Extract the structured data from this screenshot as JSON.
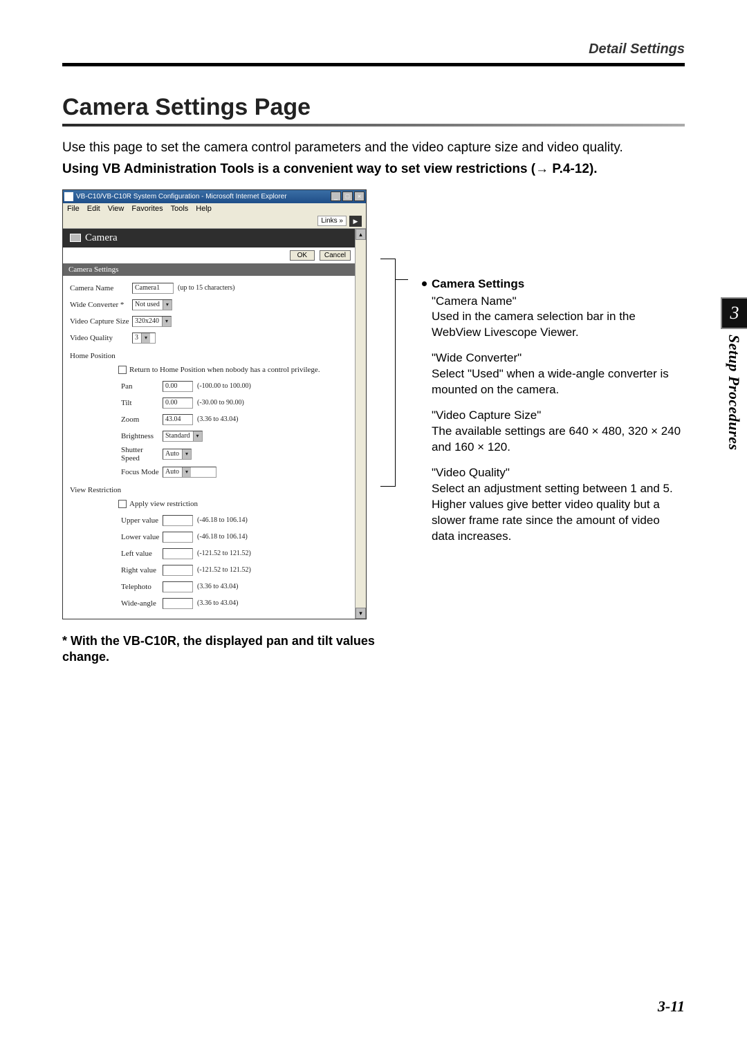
{
  "header": {
    "section_label": "Detail Settings"
  },
  "title": "Camera Settings Page",
  "intro": "Use this page to set the camera control parameters and the video capture size and video quality.",
  "bold_line": "Using VB Administration Tools is a convenient way to set view restrictions (→ P.4-12).",
  "screenshot": {
    "window_title": "VB-C10/VB-C10R System Configuration - Microsoft Internet Explorer",
    "menus": {
      "file": "File",
      "edit": "Edit",
      "view": "View",
      "favorites": "Favorites",
      "tools": "Tools",
      "help": "Help"
    },
    "links_label": "Links »",
    "panel_label": "Camera",
    "ok": "OK",
    "cancel": "Cancel",
    "section_title": "Camera Settings",
    "camera_name_label": "Camera Name",
    "camera_name_value": "Camera1",
    "camera_name_hint": "(up to 15 characters)",
    "wide_converter_label": "Wide Converter  *",
    "wide_converter_value": "Not used",
    "capture_size_label": "Video Capture Size",
    "capture_size_value": "320x240",
    "video_quality_label": "Video Quality",
    "video_quality_value": "3",
    "home_position_label": "Home Position",
    "home_checkbox_label": "Return to Home Position when nobody has a control privilege.",
    "pan": {
      "label": "Pan",
      "value": "0.00",
      "range": "(-100.00 to 100.00)"
    },
    "tilt": {
      "label": "Tilt",
      "value": "0.00",
      "range": "(-30.00 to 90.00)"
    },
    "zoom": {
      "label": "Zoom",
      "value": "43.04",
      "range": "(3.36 to 43.04)"
    },
    "brightness": {
      "label": "Brightness",
      "value": "Standard"
    },
    "shutter": {
      "label": "Shutter Speed",
      "value": "Auto"
    },
    "focus": {
      "label": "Focus Mode",
      "value": "Auto"
    },
    "view_restriction_label": "View Restriction",
    "apply_checkbox_label": "Apply view restriction",
    "upper": {
      "label": "Upper value",
      "range": "(-46.18 to 106.14)"
    },
    "lower": {
      "label": "Lower value",
      "range": "(-46.18 to 106.14)"
    },
    "left": {
      "label": "Left value",
      "range": "(-121.52 to 121.52)"
    },
    "right": {
      "label": "Right value",
      "range": "(-121.52 to 121.52)"
    },
    "telephoto": {
      "label": "Telephoto",
      "range": "(3.36 to 43.04)"
    },
    "wideangle": {
      "label": "Wide-angle",
      "range": "(3.36 to 43.04)"
    }
  },
  "descriptions": {
    "heading": "Camera Settings",
    "camera_name_title": "\"Camera Name\"",
    "camera_name_body": "Used in the camera selection bar in the WebView Livescope Viewer.",
    "wide_title": "\"Wide Converter\"",
    "wide_body": "Select \"Used\" when a wide-angle converter is mounted on the camera.",
    "capture_title": "\"Video Capture Size\"",
    "capture_body": "The available settings are 640 × 480, 320 × 240 and 160 × 120.",
    "quality_title": "\"Video Quality\"",
    "quality_body": "Select an adjustment setting between 1 and 5. Higher values give better video quality but a slower frame rate since the amount of video data increases."
  },
  "footnote": "* With the VB-C10R, the displayed pan and tilt values change.",
  "side": {
    "chapter_number": "3",
    "chapter_label": "Setup Procedures"
  },
  "page_number": "3-11"
}
